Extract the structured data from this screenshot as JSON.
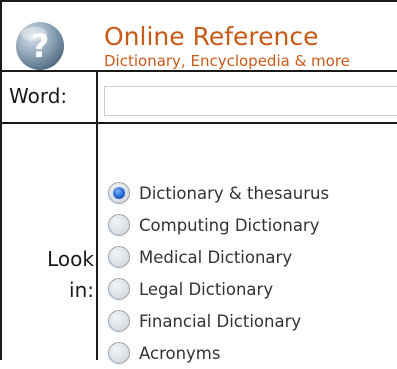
{
  "header": {
    "title": "Online Reference",
    "subtitle": "Dictionary, Encyclopedia & more",
    "logo_icon": "question-mark-circle-icon"
  },
  "search": {
    "word_label": "Word:",
    "word_value": "",
    "word_placeholder": ""
  },
  "lookin": {
    "label_line1": "Look",
    "label_line2": "in:",
    "selected": "Dictionary & thesaurus",
    "options": [
      {
        "label": "Dictionary & thesaurus",
        "checked": true
      },
      {
        "label": "Computing Dictionary",
        "checked": false
      },
      {
        "label": "Medical Dictionary",
        "checked": false
      },
      {
        "label": "Legal Dictionary",
        "checked": false
      },
      {
        "label": "Financial Dictionary",
        "checked": false
      },
      {
        "label": "Acronyms",
        "checked": false
      }
    ]
  },
  "colors": {
    "accent": "#c85a18",
    "border": "#1a1a1a",
    "radio_selected": "#1a5fd0"
  }
}
